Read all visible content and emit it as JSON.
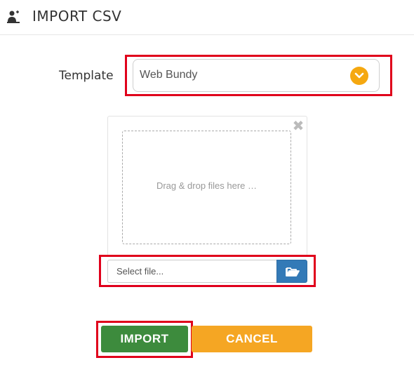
{
  "header": {
    "title": "IMPORT CSV",
    "icon": "user-import-icon"
  },
  "form": {
    "template_label": "Template",
    "template_value": "Web Bundy"
  },
  "dropzone": {
    "text": "Drag & drop files here …",
    "close_icon": "close-icon"
  },
  "file": {
    "caption": "Select file...",
    "browse_icon": "folder-open-icon"
  },
  "actions": {
    "import_label": "IMPORT",
    "cancel_label": "CANCEL"
  },
  "colors": {
    "highlight": "#e0001b",
    "import": "#3d8b3d",
    "cancel": "#f5a623",
    "browse": "#337ab7",
    "caret": "#f5a810"
  }
}
